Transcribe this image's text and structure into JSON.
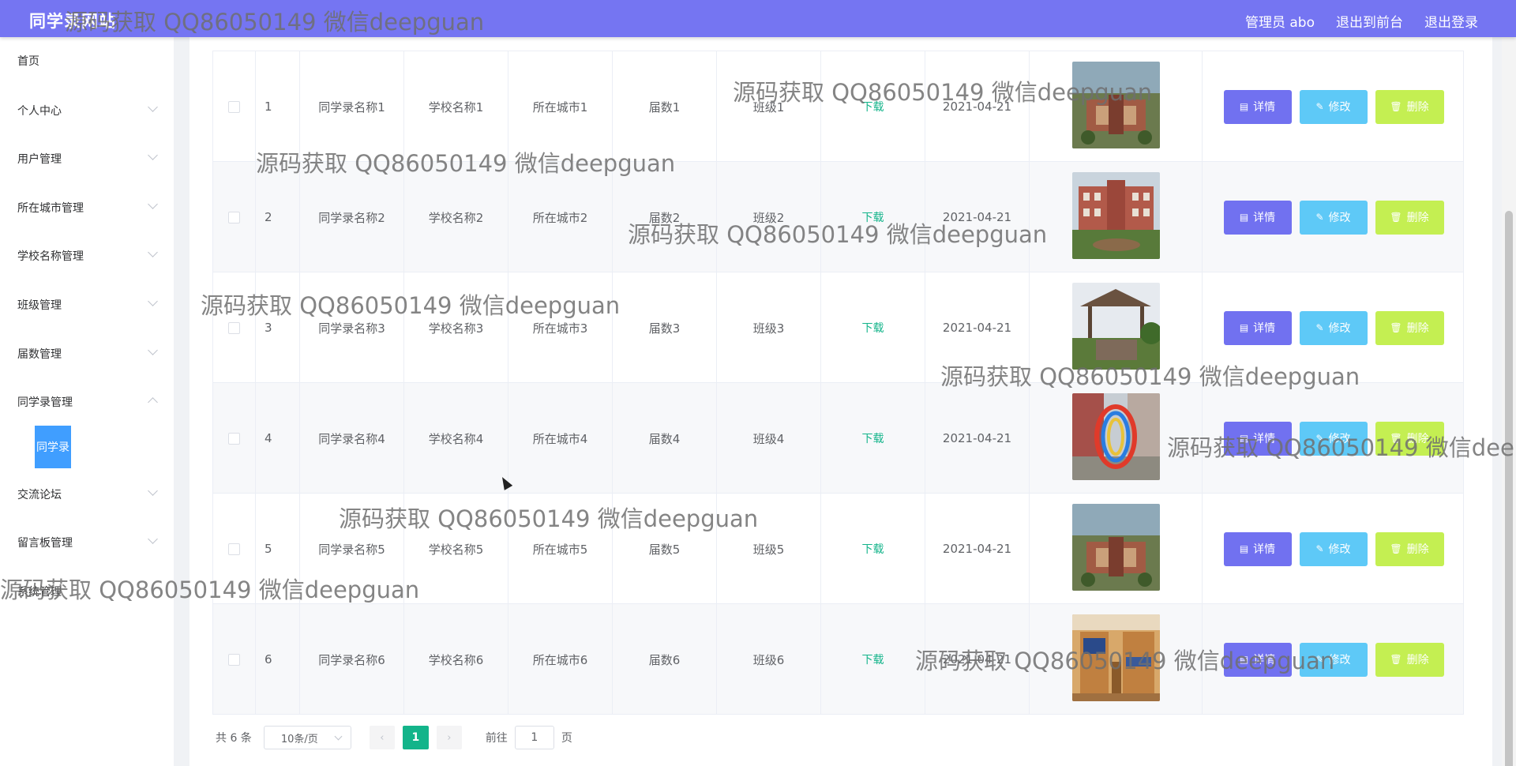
{
  "header": {
    "brand": "同学录网站",
    "user": "管理员 abo",
    "to_front": "退出到前台",
    "logout": "退出登录"
  },
  "sidebar": {
    "items": [
      {
        "label": "首页",
        "expandable": false
      },
      {
        "label": "个人中心",
        "expandable": true
      },
      {
        "label": "用户管理",
        "expandable": true
      },
      {
        "label": "所在城市管理",
        "expandable": true
      },
      {
        "label": "学校名称管理",
        "expandable": true
      },
      {
        "label": "班级管理",
        "expandable": true
      },
      {
        "label": "届数管理",
        "expandable": true
      },
      {
        "label": "同学录管理",
        "expandable": true,
        "expanded": true
      },
      {
        "label": "交流论坛",
        "expandable": true
      },
      {
        "label": "留言板管理",
        "expandable": true
      },
      {
        "label": "系统管理",
        "expandable": true
      }
    ],
    "active_sub": "同学录"
  },
  "table": {
    "rows": [
      {
        "idx": "1",
        "name": "同学录名称1",
        "school": "学校名称1",
        "city": "所在城市1",
        "session": "届数1",
        "cls": "班级1",
        "file": "下载",
        "date": "2021-04-21",
        "image": "campus-aerial"
      },
      {
        "idx": "2",
        "name": "同学录名称2",
        "school": "学校名称2",
        "city": "所在城市2",
        "session": "届数2",
        "cls": "班级2",
        "file": "下载",
        "date": "2021-04-21",
        "image": "school-building"
      },
      {
        "idx": "3",
        "name": "同学录名称3",
        "school": "学校名称3",
        "city": "所在城市3",
        "session": "届数3",
        "cls": "班级3",
        "file": "下载",
        "date": "2021-04-21",
        "image": "garden-pavilion"
      },
      {
        "idx": "4",
        "name": "同学录名称4",
        "school": "学校名称4",
        "city": "所在城市4",
        "session": "届数4",
        "cls": "班级4",
        "file": "下载",
        "date": "2021-04-21",
        "image": "ring-sculpture"
      },
      {
        "idx": "5",
        "name": "同学录名称5",
        "school": "学校名称5",
        "city": "所在城市5",
        "session": "届数5",
        "cls": "班级5",
        "file": "下载",
        "date": "2021-04-21",
        "image": "campus-aerial"
      },
      {
        "idx": "6",
        "name": "同学录名称6",
        "school": "学校名称6",
        "city": "所在城市6",
        "session": "届数6",
        "cls": "班级6",
        "file": "下载",
        "date": "2021-04-21",
        "image": "dorm-room"
      }
    ],
    "actions": {
      "detail": "详情",
      "edit": "修改",
      "delete": "删除"
    }
  },
  "pagination": {
    "total": "共 6 条",
    "page_size": "10条/页",
    "current_page": "1",
    "goto_prefix": "前往",
    "goto_value": "1",
    "goto_suffix": "页"
  },
  "watermark": "源码获取 QQ86050149 微信deepguan",
  "colors": {
    "header": "#7575f2",
    "detail": "#7171f0",
    "edit": "#5ec9f7",
    "delete": "#c4ef52",
    "accent": "#13b48a",
    "active_menu": "#409eff"
  }
}
